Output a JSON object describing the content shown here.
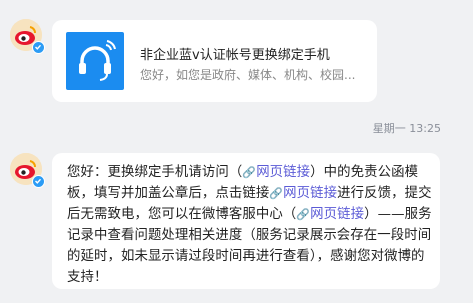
{
  "messages": [
    {
      "type": "link-card",
      "title": "非企业蓝v认证帐号更换绑定手机",
      "description": "您好，如您是政府、媒体、机构、校园..."
    },
    {
      "type": "timestamp",
      "text": "星期一 13:25"
    },
    {
      "type": "text",
      "segments": {
        "s1": "您好：更换绑定手机请访问（",
        "link1": "网页链接",
        "s2": "）中的免责公函模板，填写并加盖公章后，点击链接",
        "link2": "网页链接",
        "s3": "进行反馈，提交后无需致电，您可以在微博客服中心（",
        "link3": "网页链接",
        "s4": "）——服务记录中查看问题处理相关进度（服务记录展示会存在一段时间的延时，如未显示请过段时间再进行查看），感谢您对微博的支持！"
      }
    }
  ],
  "icons": {
    "avatar": "weibo-logo-avatar",
    "verified_badge": "verified-check-badge",
    "card_thumb": "headset-icon",
    "link": "link-icon"
  },
  "colors": {
    "background": "#f0f1f3",
    "link": "#5b5bd6",
    "card_thumb_bg": "#1b8cf0",
    "verified": "#2c9cf5"
  }
}
